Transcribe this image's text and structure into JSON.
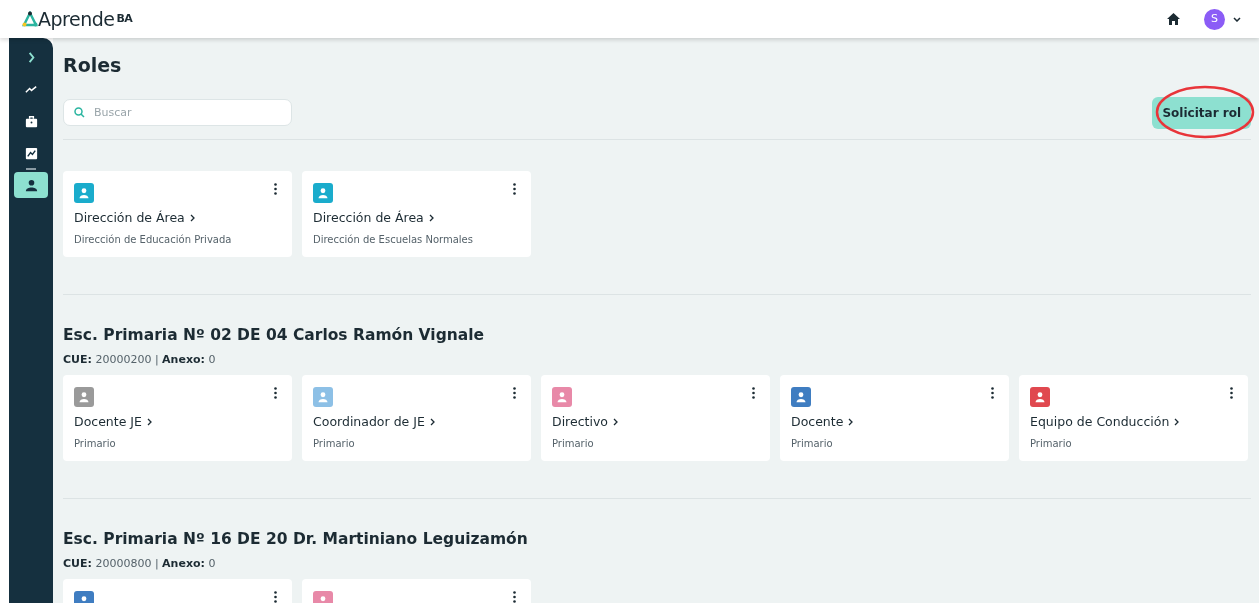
{
  "header": {
    "logo": "Aprende",
    "logo_suffix": "BA",
    "avatar_initial": "S"
  },
  "sidebar": {
    "items": [
      {
        "kind": "expand",
        "selected": false
      },
      {
        "kind": "trend",
        "selected": false
      },
      {
        "kind": "briefcase",
        "selected": false
      },
      {
        "kind": "chart",
        "selected": false
      },
      {
        "kind": "divider",
        "selected": false
      },
      {
        "kind": "person",
        "selected": true
      }
    ]
  },
  "page_title": "Roles",
  "search": {
    "placeholder": "Buscar"
  },
  "request_button": {
    "label": "Solicitar rol",
    "highlighted": true
  },
  "sections": [
    {
      "cards": [
        {
          "title": "Dirección de Área",
          "subtitle": "Dirección de Educación Privada",
          "color": "#1aaccc"
        },
        {
          "title": "Dirección de Área",
          "subtitle": "Dirección de Escuelas Normales",
          "color": "#1aaccc"
        }
      ]
    },
    {
      "title": "Esc. Primaria Nº 02 DE 04 Carlos Ramón Vignale",
      "info": "**CUE:** 20000200 | **Anexo:** 0",
      "cards": [
        {
          "title": "Docente JE",
          "subtitle": "Primario",
          "color": "#9a9a9a"
        },
        {
          "title": "Coordinador de JE",
          "subtitle": "Primario",
          "color": "#8dc0e6"
        },
        {
          "title": "Directivo",
          "subtitle": "Primario",
          "color": "#e889a8"
        },
        {
          "title": "Docente",
          "subtitle": "Primario",
          "color": "#3f7dc1"
        },
        {
          "title": "Equipo de Conducción",
          "subtitle": "Primario",
          "color": "#e0484f"
        }
      ]
    },
    {
      "title": "Esc. Primaria Nº 16 DE 20 Dr. Martiniano Leguizamón",
      "info": "**CUE:** 20000800 | **Anexo:** 0",
      "cards": [
        {
          "color": "#3f7dc1"
        },
        {
          "color": "#e889a8"
        }
      ]
    }
  ]
}
